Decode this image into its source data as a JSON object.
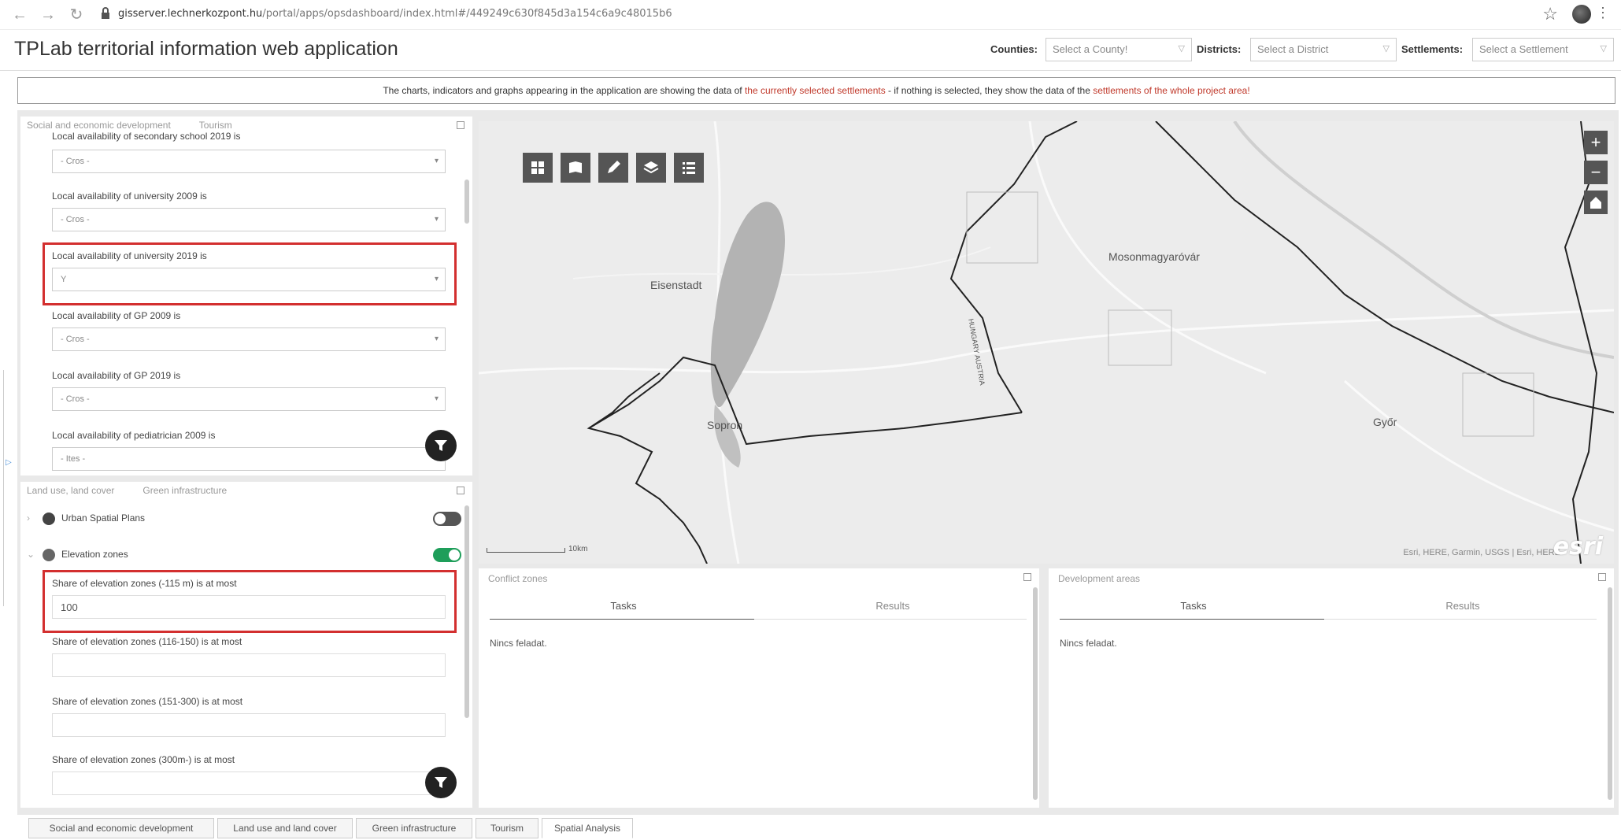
{
  "browser": {
    "url_host": "gisserver.lechnerkozpont.hu",
    "url_path": "/portal/apps/opsdashboard/index.html#/449249c630f845d3a154c6a9c48015b6"
  },
  "app": {
    "title": "TPLab territorial information web application"
  },
  "filters": {
    "counties_label": "Counties:",
    "counties_value": "Select a County!",
    "districts_label": "Districts:",
    "districts_value": "Select a District",
    "settlements_label": "Settlements:",
    "settlements_value": "Select a Settlement"
  },
  "banner": {
    "part1": "The charts, indicators and graphs appearing in the application are showing the data of ",
    "hl1": "the currently selected settlements",
    "part2": " - if nothing is selected, they show the data of the ",
    "hl2": "settlements of the whole project area!"
  },
  "social_panel": {
    "tabs": [
      "Social and economic development",
      "Tourism"
    ],
    "top_cut_label": "Local availability of secondary school 2019 is",
    "fields": [
      {
        "label": "Local availability of university 2009 is",
        "value": "- Cros -"
      },
      {
        "label": "Local availability of university 2019 is",
        "value": "Y"
      },
      {
        "label": "Local availability of GP 2009 is",
        "value": "- Cros -"
      },
      {
        "label": "Local availability of GP 2019 is",
        "value": "- Cros -"
      },
      {
        "label": "Local availability of pediatrician 2009 is",
        "value": "- Ites -"
      }
    ],
    "first_value": "- Cros -"
  },
  "land_panel": {
    "tabs": [
      "Land use, land cover",
      "Green infrastructure"
    ],
    "layers": [
      {
        "label": "Urban Spatial Plans",
        "on": false
      },
      {
        "label": "Elevation zones",
        "on": true
      }
    ],
    "fields": [
      {
        "label": "Share of elevation zones (-115 m) is at most",
        "value": "100"
      },
      {
        "label": "Share of elevation zones (116-150) is at most",
        "value": ""
      },
      {
        "label": "Share of elevation zones (151-300) is at most",
        "value": ""
      },
      {
        "label": "Share of elevation zones (300m-) is at most",
        "value": ""
      }
    ]
  },
  "map": {
    "labels": {
      "eisenstadt": "Eisenstadt",
      "mosonmagyarovar": "Mosonmagyaróvár",
      "sopron": "Sopron",
      "gyor": "Győr",
      "border": "HUNGARY AUSTRIA"
    },
    "scale": "10km",
    "attribution": "Esri, HERE, Garmin, USGS | Esri, HERE",
    "esri_logo": "esri",
    "zoom_in": "+",
    "zoom_out": "−"
  },
  "conflict_panel": {
    "title": "Conflict zones",
    "tab_tasks": "Tasks",
    "tab_results": "Results",
    "empty": "Nincs feladat."
  },
  "development_panel": {
    "title": "Development areas",
    "tab_tasks": "Tasks",
    "tab_results": "Results",
    "empty": "Nincs feladat."
  },
  "bottom_tabs": [
    "Social and economic development",
    "Land use and land cover",
    "Green infrastructure",
    "Tourism",
    "Spatial Analysis"
  ],
  "colors": {
    "highlight": "#d32f2f",
    "toggle_on": "#1e9e5a",
    "toggle_off": "#555555",
    "banner_highlight": "#c0392b"
  }
}
